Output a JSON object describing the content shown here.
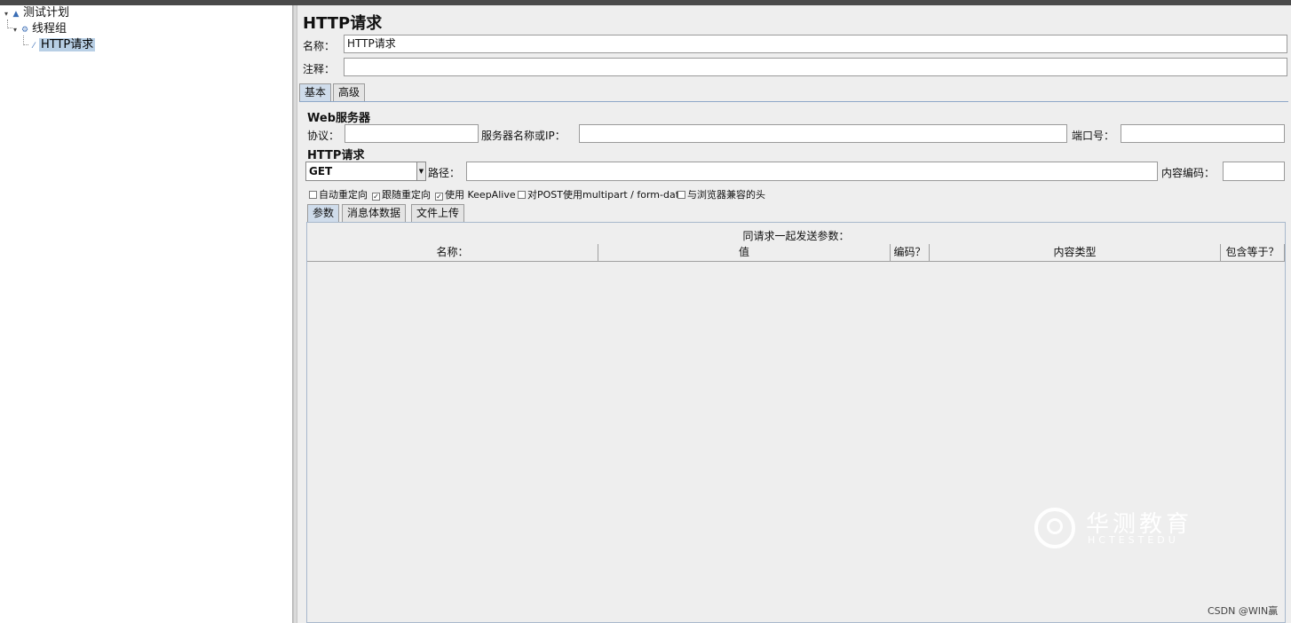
{
  "tree": {
    "items": [
      {
        "label": "测试计划",
        "icon": "test-plan-icon"
      },
      {
        "label": "线程组",
        "icon": "thread-group-icon"
      },
      {
        "label": "HTTP请求",
        "icon": "sampler-icon"
      }
    ]
  },
  "page": {
    "title": "HTTP请求",
    "name_label": "名称：",
    "name_value": "HTTP请求",
    "comment_label": "注释：",
    "comment_value": ""
  },
  "tabs": {
    "basic": "基本",
    "advanced": "高级"
  },
  "web_server": {
    "title": "Web服务器",
    "protocol_label": "协议：",
    "protocol_value": "",
    "server_label": "服务器名称或IP：",
    "server_value": "",
    "port_label": "端口号：",
    "port_value": ""
  },
  "http_request": {
    "title": "HTTP请求",
    "method": "GET",
    "path_label": "路径：",
    "path_value": "",
    "encoding_label": "内容编码：",
    "encoding_value": ""
  },
  "options": [
    {
      "label": "自动重定向",
      "checked": false
    },
    {
      "label": "跟随重定向",
      "checked": true
    },
    {
      "label": "使用 KeepAlive",
      "checked": true
    },
    {
      "label": "对POST使用multipart / form-data",
      "checked": false
    },
    {
      "label": "与浏览器兼容的头",
      "checked": false
    }
  ],
  "subtabs": {
    "params": "参数",
    "body": "消息体数据",
    "files": "文件上传"
  },
  "params_table": {
    "caption": "同请求一起发送参数：",
    "columns": [
      "名称：",
      "值",
      "编码？",
      "内容类型",
      "包含等于？"
    ]
  },
  "watermark": {
    "title": "华测教育",
    "subtitle": "HCTESTEDU"
  },
  "credit": "CSDN @WIN赢"
}
